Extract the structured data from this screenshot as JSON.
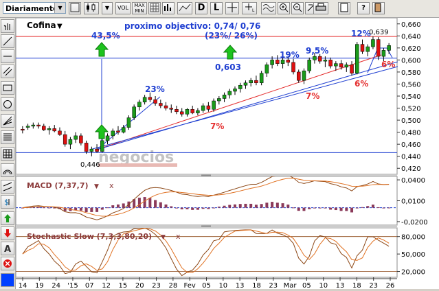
{
  "toolbar": {
    "period": "Diariamente",
    "buttons": [
      "VOL",
      "MAX\nMIN",
      "D",
      "L"
    ]
  },
  "sidebar": {
    "icons": [
      "hand-icon",
      "line-icon",
      "hline-icon",
      "parallel-icon",
      "rect-icon",
      "circle-icon",
      "fan-icon",
      "fib-icon",
      "grid-icon",
      "arc-icon",
      "channel-icon",
      "dollar-icon",
      "up-arrow-icon",
      "down-arrow-icon",
      "text-icon",
      "delete-icon",
      "color-icon"
    ]
  },
  "main": {
    "symbol": "Cofina",
    "watermark": "negocios",
    "annotations": {
      "objective": "proximo objectivo: 0,74/ 0,76",
      "objective_pct": "(23%/ 26%)",
      "pct_43": "43,5%",
      "pct_23": "23%",
      "pct_7a": "7%",
      "pct_19": "19%",
      "pct_95": "9,5%",
      "pct_7b": "7%",
      "pct_6a": "6%",
      "pct_12": "12%",
      "pct_6b": "6%",
      "val_603": "0,603",
      "val_639": "0,639",
      "val_446": "0,446"
    }
  },
  "chart_data": {
    "type": "candlestick",
    "price": {
      "ylim": [
        0.41,
        0.67
      ],
      "yticks": [
        "0,660",
        "0,640",
        "0,620",
        "0,600",
        "0,580",
        "0,560",
        "0,540",
        "0,520",
        "0,500",
        "0,480",
        "0,460",
        "0,440",
        "0,420"
      ],
      "hlines": [
        0.639,
        0.603,
        0.446
      ],
      "candles": [
        {
          "o": 0.485,
          "h": 0.49,
          "l": 0.478,
          "c": 0.484
        },
        {
          "o": 0.488,
          "h": 0.494,
          "l": 0.484,
          "c": 0.49
        },
        {
          "o": 0.49,
          "h": 0.496,
          "l": 0.486,
          "c": 0.492
        },
        {
          "o": 0.492,
          "h": 0.496,
          "l": 0.486,
          "c": 0.49
        },
        {
          "o": 0.49,
          "h": 0.494,
          "l": 0.482,
          "c": 0.484
        },
        {
          "o": 0.484,
          "h": 0.49,
          "l": 0.476,
          "c": 0.486
        },
        {
          "o": 0.486,
          "h": 0.492,
          "l": 0.48,
          "c": 0.482
        },
        {
          "o": 0.482,
          "h": 0.488,
          "l": 0.474,
          "c": 0.476
        },
        {
          "o": 0.476,
          "h": 0.482,
          "l": 0.456,
          "c": 0.46
        },
        {
          "o": 0.46,
          "h": 0.472,
          "l": 0.452,
          "c": 0.468
        },
        {
          "o": 0.468,
          "h": 0.48,
          "l": 0.462,
          "c": 0.474
        },
        {
          "o": 0.474,
          "h": 0.478,
          "l": 0.458,
          "c": 0.462
        },
        {
          "o": 0.462,
          "h": 0.466,
          "l": 0.444,
          "c": 0.448
        },
        {
          "o": 0.448,
          "h": 0.456,
          "l": 0.44,
          "c": 0.452
        },
        {
          "o": 0.452,
          "h": 0.46,
          "l": 0.446,
          "c": 0.448
        },
        {
          "o": 0.448,
          "h": 0.47,
          "l": 0.446,
          "c": 0.466
        },
        {
          "o": 0.466,
          "h": 0.478,
          "l": 0.46,
          "c": 0.474
        },
        {
          "o": 0.474,
          "h": 0.486,
          "l": 0.468,
          "c": 0.482
        },
        {
          "o": 0.482,
          "h": 0.49,
          "l": 0.476,
          "c": 0.48
        },
        {
          "o": 0.48,
          "h": 0.492,
          "l": 0.478,
          "c": 0.488
        },
        {
          "o": 0.488,
          "h": 0.508,
          "l": 0.484,
          "c": 0.504
        },
        {
          "o": 0.504,
          "h": 0.526,
          "l": 0.5,
          "c": 0.522
        },
        {
          "o": 0.522,
          "h": 0.534,
          "l": 0.516,
          "c": 0.53
        },
        {
          "o": 0.53,
          "h": 0.542,
          "l": 0.526,
          "c": 0.538
        },
        {
          "o": 0.538,
          "h": 0.546,
          "l": 0.53,
          "c": 0.534
        },
        {
          "o": 0.534,
          "h": 0.54,
          "l": 0.524,
          "c": 0.528
        },
        {
          "o": 0.528,
          "h": 0.534,
          "l": 0.52,
          "c": 0.524
        },
        {
          "o": 0.524,
          "h": 0.53,
          "l": 0.516,
          "c": 0.52
        },
        {
          "o": 0.52,
          "h": 0.526,
          "l": 0.512,
          "c": 0.518
        },
        {
          "o": 0.518,
          "h": 0.524,
          "l": 0.51,
          "c": 0.514
        },
        {
          "o": 0.514,
          "h": 0.52,
          "l": 0.506,
          "c": 0.51
        },
        {
          "o": 0.51,
          "h": 0.52,
          "l": 0.506,
          "c": 0.518
        },
        {
          "o": 0.518,
          "h": 0.524,
          "l": 0.51,
          "c": 0.512
        },
        {
          "o": 0.512,
          "h": 0.52,
          "l": 0.508,
          "c": 0.516
        },
        {
          "o": 0.516,
          "h": 0.528,
          "l": 0.512,
          "c": 0.524
        },
        {
          "o": 0.524,
          "h": 0.53,
          "l": 0.514,
          "c": 0.518
        },
        {
          "o": 0.518,
          "h": 0.536,
          "l": 0.514,
          "c": 0.532
        },
        {
          "o": 0.532,
          "h": 0.54,
          "l": 0.526,
          "c": 0.536
        },
        {
          "o": 0.536,
          "h": 0.546,
          "l": 0.53,
          "c": 0.542
        },
        {
          "o": 0.542,
          "h": 0.552,
          "l": 0.536,
          "c": 0.548
        },
        {
          "o": 0.548,
          "h": 0.556,
          "l": 0.542,
          "c": 0.552
        },
        {
          "o": 0.552,
          "h": 0.562,
          "l": 0.546,
          "c": 0.558
        },
        {
          "o": 0.558,
          "h": 0.566,
          "l": 0.552,
          "c": 0.562
        },
        {
          "o": 0.562,
          "h": 0.57,
          "l": 0.556,
          "c": 0.566
        },
        {
          "o": 0.566,
          "h": 0.574,
          "l": 0.558,
          "c": 0.562
        },
        {
          "o": 0.562,
          "h": 0.582,
          "l": 0.558,
          "c": 0.578
        },
        {
          "o": 0.578,
          "h": 0.596,
          "l": 0.572,
          "c": 0.592
        },
        {
          "o": 0.592,
          "h": 0.606,
          "l": 0.586,
          "c": 0.6
        },
        {
          "o": 0.6,
          "h": 0.608,
          "l": 0.59,
          "c": 0.594
        },
        {
          "o": 0.594,
          "h": 0.604,
          "l": 0.586,
          "c": 0.6
        },
        {
          "o": 0.6,
          "h": 0.606,
          "l": 0.59,
          "c": 0.596
        },
        {
          "o": 0.596,
          "h": 0.602,
          "l": 0.576,
          "c": 0.58
        },
        {
          "o": 0.58,
          "h": 0.584,
          "l": 0.562,
          "c": 0.566
        },
        {
          "o": 0.566,
          "h": 0.586,
          "l": 0.56,
          "c": 0.582
        },
        {
          "o": 0.582,
          "h": 0.604,
          "l": 0.578,
          "c": 0.6
        },
        {
          "o": 0.6,
          "h": 0.612,
          "l": 0.594,
          "c": 0.606
        },
        {
          "o": 0.606,
          "h": 0.61,
          "l": 0.594,
          "c": 0.598
        },
        {
          "o": 0.598,
          "h": 0.606,
          "l": 0.588,
          "c": 0.6
        },
        {
          "o": 0.6,
          "h": 0.604,
          "l": 0.586,
          "c": 0.59
        },
        {
          "o": 0.59,
          "h": 0.598,
          "l": 0.582,
          "c": 0.594
        },
        {
          "o": 0.594,
          "h": 0.6,
          "l": 0.584,
          "c": 0.588
        },
        {
          "o": 0.588,
          "h": 0.596,
          "l": 0.58,
          "c": 0.592
        },
        {
          "o": 0.592,
          "h": 0.598,
          "l": 0.574,
          "c": 0.578
        },
        {
          "o": 0.578,
          "h": 0.63,
          "l": 0.576,
          "c": 0.626
        },
        {
          "o": 0.626,
          "h": 0.634,
          "l": 0.61,
          "c": 0.614
        },
        {
          "o": 0.614,
          "h": 0.626,
          "l": 0.606,
          "c": 0.622
        },
        {
          "o": 0.622,
          "h": 0.639,
          "l": 0.618,
          "c": 0.634
        },
        {
          "o": 0.634,
          "h": 0.638,
          "l": 0.6,
          "c": 0.606
        },
        {
          "o": 0.606,
          "h": 0.62,
          "l": 0.598,
          "c": 0.616
        },
        {
          "o": 0.616,
          "h": 0.628,
          "l": 0.61,
          "c": 0.624
        }
      ]
    },
    "macd": {
      "label": "MACD (7,37,7)",
      "yticks": [
        "0,0400",
        "0,0100",
        "-0,0200"
      ],
      "ylim": [
        -0.025,
        0.045
      ]
    },
    "stochastic": {
      "label": "Stochastic Slow (7,3,3,80,20)",
      "yticks": [
        "80,000",
        "50,000",
        "20,000"
      ],
      "ylim": [
        10,
        95
      ]
    },
    "x_ticks": [
      "14",
      "19",
      "24",
      "'15",
      "07",
      "12",
      "15",
      "20",
      "23",
      "28",
      "Fev",
      "05",
      "10",
      "13",
      "18",
      "23",
      "Mar",
      "05",
      "10",
      "13",
      "18",
      "23",
      "26"
    ]
  }
}
